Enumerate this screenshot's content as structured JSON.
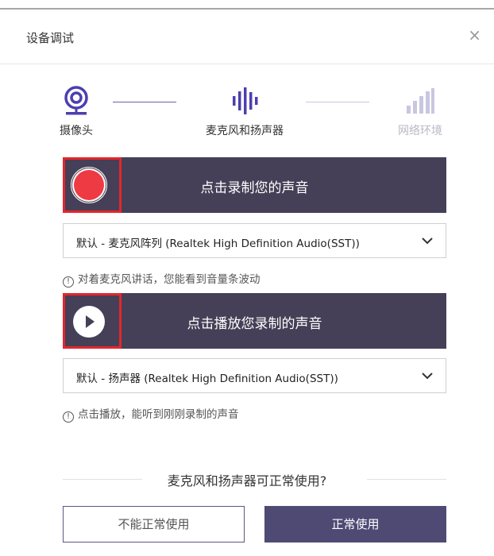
{
  "dialog": {
    "title": "设备调试",
    "close_glyph": "×"
  },
  "steps": [
    {
      "label": "摄像头",
      "icon": "webcam-icon",
      "state": "done"
    },
    {
      "label": "麦克风和扬声器",
      "icon": "audio-wave-icon",
      "state": "active"
    },
    {
      "label": "网络环境",
      "icon": "signal-bars-icon",
      "state": "pending"
    }
  ],
  "record": {
    "label": "点击录制您的声音",
    "icon": "record-dot-icon"
  },
  "mic_select": {
    "value": "默认 - 麦克风阵列 (Realtek High Definition Audio(SST))"
  },
  "hint_mic": {
    "icon": "info-icon",
    "text": "对着麦克风讲话，您能看到音量条波动"
  },
  "playback": {
    "label": "点击播放您录制的声音",
    "icon": "play-icon"
  },
  "speaker_select": {
    "value": "默认 - 扬声器 (Realtek High Definition Audio(SST))"
  },
  "hint_speaker": {
    "icon": "info-icon",
    "text": "点击播放，能听到刚刚录制的声音"
  },
  "question": "麦克风和扬声器可正常使用?",
  "buttons": {
    "not_working": "不能正常使用",
    "working": "正常使用"
  },
  "colors": {
    "accent": "#454057",
    "button_primary": "#4f4a74",
    "record_red": "#ee3a43",
    "highlight": "#e5262b",
    "pending_step": "#b8b8c4"
  }
}
